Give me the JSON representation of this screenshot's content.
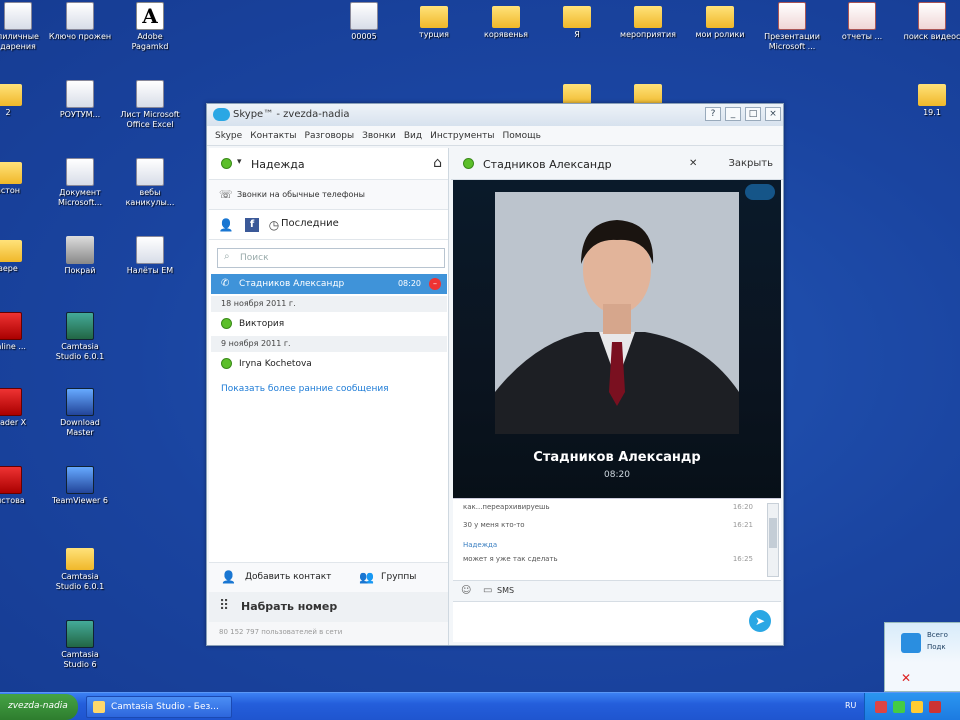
{
  "desktop_icons": [
    {
      "name": "desktop-icon-1",
      "label": "пиличные дарения",
      "type": "doc"
    },
    {
      "name": "desktop-icon-2",
      "label": "Ключо прожен",
      "type": "doc"
    },
    {
      "name": "desktop-icon-3",
      "label": "Adobe Pagamkd",
      "type": "font"
    },
    {
      "name": "desktop-icon-4",
      "label": "00005",
      "type": "doc"
    },
    {
      "name": "desktop-icon-5",
      "label": "турция",
      "type": "folder"
    },
    {
      "name": "desktop-icon-6",
      "label": "корявенья",
      "type": "folder"
    },
    {
      "name": "desktop-icon-7",
      "label": "Я",
      "type": "folder"
    },
    {
      "name": "desktop-icon-8",
      "label": "мероприятия",
      "type": "folder"
    },
    {
      "name": "desktop-icon-9",
      "label": "мои ролики",
      "type": "folder"
    },
    {
      "name": "desktop-icon-10",
      "label": "Презентации Microsoft ...",
      "type": "doc-red"
    },
    {
      "name": "desktop-icon-11",
      "label": "отчеты ...",
      "type": "doc-red"
    },
    {
      "name": "desktop-icon-12",
      "label": "поиск видеос",
      "type": "doc-red"
    },
    {
      "name": "desktop-icon-13",
      "label": "2",
      "type": "folder"
    },
    {
      "name": "desktop-icon-14",
      "label": "РОУТУМ...",
      "type": "doc"
    },
    {
      "name": "desktop-icon-15",
      "label": "Лист Microsoft Office Excel",
      "type": "doc"
    },
    {
      "name": "desktop-icon-16",
      "label": "19.1",
      "type": "folder"
    },
    {
      "name": "desktop-icon-17",
      "label": "астон",
      "type": "folder"
    },
    {
      "name": "desktop-icon-18",
      "label": "Документ Microsoft...",
      "type": "doc"
    },
    {
      "name": "desktop-icon-19",
      "label": "вебы каникулы...",
      "type": "doc"
    },
    {
      "name": "desktop-icon-20",
      "label": "вере",
      "type": "folder"
    },
    {
      "name": "desktop-icon-21",
      "label": "Покрай",
      "type": "pad"
    },
    {
      "name": "desktop-icon-22",
      "label": "Налёты ЕМ",
      "type": "doc"
    },
    {
      "name": "desktop-icon-23",
      "label": "Online ...",
      "type": "pdf"
    },
    {
      "name": "desktop-icon-24",
      "label": "Camtasia Studio 6.0.1",
      "type": "cam"
    },
    {
      "name": "desktop-icon-25",
      "label": "Reader X",
      "type": "pdf"
    },
    {
      "name": "desktop-icon-26",
      "label": "Download Master",
      "type": "blue"
    },
    {
      "name": "desktop-icon-27",
      "label": "алстова",
      "type": "pdf"
    },
    {
      "name": "desktop-icon-28",
      "label": "TeamViewer 6",
      "type": "blue"
    },
    {
      "name": "desktop-icon-29",
      "label": "Camtasia Studio 6.0.1",
      "type": "folder"
    },
    {
      "name": "desktop-icon-30",
      "label": "Camtasia Studio 6",
      "type": "cam"
    }
  ],
  "skype": {
    "title": "Skype™ - zvezda-nadia",
    "menu": [
      "Skype",
      "Контакты",
      "Разговоры",
      "Звонки",
      "Вид",
      "Инструменты",
      "Помощь"
    ],
    "profile_name": "Надежда",
    "call_phones": "Звонки на обычные телефоны",
    "tab_recent": "Последние",
    "search_placeholder": "Поиск",
    "conversations": [
      {
        "kind": "item",
        "label": "Стадников Александр",
        "time": "08:20",
        "selected": true
      },
      {
        "kind": "date",
        "label": "18 ноября 2011 г."
      },
      {
        "kind": "item",
        "label": "Виктория"
      },
      {
        "kind": "date",
        "label": "9 ноября 2011 г."
      },
      {
        "kind": "item",
        "label": "Iryna Kochetova"
      }
    ],
    "show_more": "Показать более ранние сообщения",
    "add_contact": "Добавить контакт",
    "groups": "Группы",
    "dial": "Набрать номер",
    "status_line": "80 152 797 пользователей в сети",
    "conv_name": "Стадников Александр",
    "close": "Закрыть",
    "video_name": "Стадников Александр",
    "video_time": "08:20",
    "messages": [
      {
        "text": "как...переархивируешь",
        "time": "16:20",
        "author": false
      },
      {
        "text": "30 у меня кто-то",
        "time": "16:21",
        "author": false
      },
      {
        "text": "Надежда",
        "time": "",
        "author": true
      },
      {
        "text": "может я уже так сделать",
        "time": "16:25",
        "author": false
      }
    ],
    "sms_label": "SMS"
  },
  "notify": {
    "line1": "Всего",
    "line2": "Подк"
  },
  "taskbar": {
    "start": "zvezda-nadia",
    "items": [
      "Camtasia Studio - Без..."
    ],
    "lang": "RU"
  }
}
